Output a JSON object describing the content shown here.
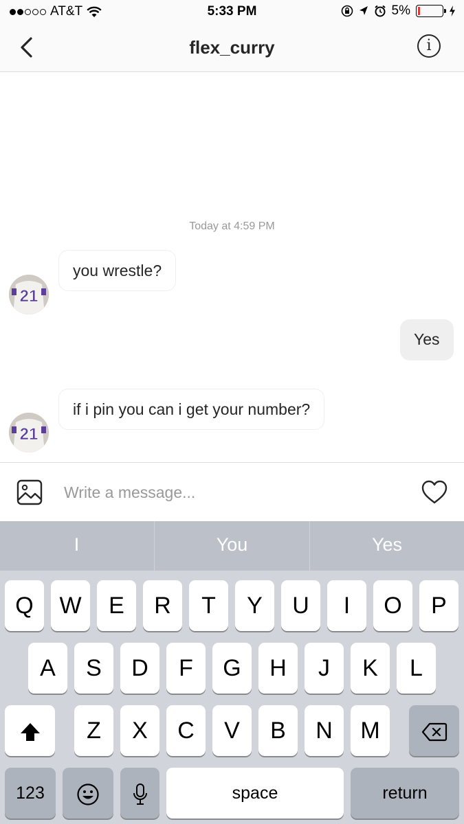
{
  "status_bar": {
    "carrier": "AT&T",
    "time": "5:33 PM",
    "battery": "5%",
    "battery_level": 0.05,
    "icons": [
      "signal-dots-icon",
      "wifi-icon",
      "orientation-lock-icon",
      "location-icon",
      "alarm-icon",
      "battery-icon",
      "charging-icon"
    ]
  },
  "header": {
    "title": "flex_curry",
    "back_icon": "chevron-left-icon",
    "info_label": "i"
  },
  "chat": {
    "timestamp": "Today at 4:59 PM",
    "messages": [
      {
        "direction": "incoming",
        "text": "you wrestle?"
      },
      {
        "direction": "outgoing",
        "text": "Yes"
      },
      {
        "direction": "incoming",
        "text": "if i pin you can i get your number?"
      }
    ],
    "avatar_number": "21"
  },
  "composer": {
    "placeholder": "Write a message...",
    "value": "",
    "gallery_icon": "image-icon",
    "like_icon": "heart-icon"
  },
  "keyboard": {
    "suggestions": [
      "I",
      "You",
      "Yes"
    ],
    "row1": [
      "Q",
      "W",
      "E",
      "R",
      "T",
      "Y",
      "U",
      "I",
      "O",
      "P"
    ],
    "row2": [
      "A",
      "S",
      "D",
      "F",
      "G",
      "H",
      "J",
      "K",
      "L"
    ],
    "row3": [
      "Z",
      "X",
      "C",
      "V",
      "B",
      "N",
      "M"
    ],
    "numbers_label": "123",
    "space_label": "space",
    "return_label": "return"
  },
  "colors": {
    "keyboard_bg": "#d1d4da",
    "suggestion_bg": "#bcc0c8",
    "outgoing_bubble": "#efefef",
    "avatar_purple": "#5b3f9b"
  }
}
